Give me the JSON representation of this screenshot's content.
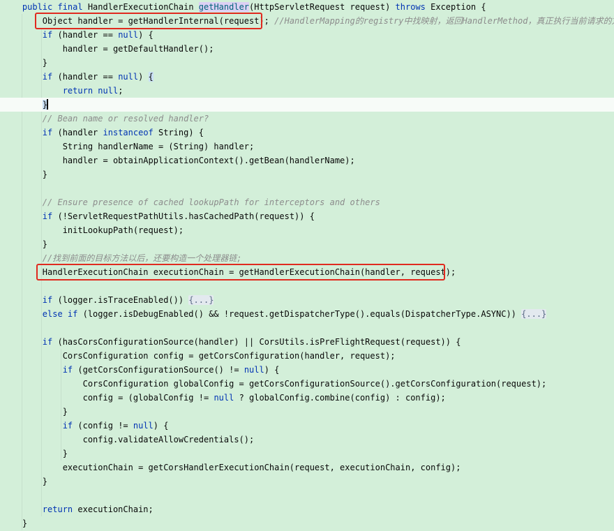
{
  "editor": {
    "lines": [
      {
        "segments": [
          {
            "t": "    ",
            "c": ""
          },
          {
            "t": "public final ",
            "c": "kw"
          },
          {
            "t": "HandlerExecutionChain ",
            "c": ""
          },
          {
            "t": "getHandler",
            "c": "method"
          },
          {
            "t": "(HttpServletRequest request) ",
            "c": ""
          },
          {
            "t": "throws ",
            "c": "kw"
          },
          {
            "t": "Exception {",
            "c": ""
          }
        ]
      },
      {
        "segments": [
          {
            "t": "        Object handler = getHandlerInternal(request); ",
            "c": ""
          },
          {
            "t": "//HandlerMapping的registry中找映射，返回HandlerMethod，真正执行当前请求的方法",
            "c": "cmt"
          }
        ]
      },
      {
        "segments": [
          {
            "t": "        ",
            "c": ""
          },
          {
            "t": "if ",
            "c": "kw"
          },
          {
            "t": "(handler == ",
            "c": ""
          },
          {
            "t": "null",
            "c": "kw"
          },
          {
            "t": ") {",
            "c": ""
          }
        ]
      },
      {
        "segments": [
          {
            "t": "            handler = getDefaultHandler();",
            "c": ""
          }
        ]
      },
      {
        "segments": [
          {
            "t": "        }",
            "c": ""
          }
        ]
      },
      {
        "segments": [
          {
            "t": "        ",
            "c": ""
          },
          {
            "t": "if ",
            "c": "kw"
          },
          {
            "t": "(handler == ",
            "c": ""
          },
          {
            "t": "null",
            "c": "kw"
          },
          {
            "t": ") ",
            "c": ""
          },
          {
            "t": "{",
            "c": "brace-match"
          }
        ]
      },
      {
        "segments": [
          {
            "t": "            ",
            "c": ""
          },
          {
            "t": "return null",
            "c": "kw"
          },
          {
            "t": ";",
            "c": ""
          }
        ]
      },
      {
        "segments": [
          {
            "t": "        ",
            "c": ""
          },
          {
            "t": "}",
            "c": "brace-match"
          },
          {
            "t": "",
            "c": "caret"
          }
        ],
        "current": true
      },
      {
        "segments": [
          {
            "t": "        ",
            "c": ""
          },
          {
            "t": "// Bean name or resolved handler?",
            "c": "cmt"
          }
        ]
      },
      {
        "segments": [
          {
            "t": "        ",
            "c": ""
          },
          {
            "t": "if ",
            "c": "kw"
          },
          {
            "t": "(handler ",
            "c": ""
          },
          {
            "t": "instanceof ",
            "c": "kw"
          },
          {
            "t": "String) {",
            "c": ""
          }
        ]
      },
      {
        "segments": [
          {
            "t": "            String handlerName = (String) handler;",
            "c": ""
          }
        ]
      },
      {
        "segments": [
          {
            "t": "            handler = obtainApplicationContext().getBean(handlerName);",
            "c": ""
          }
        ]
      },
      {
        "segments": [
          {
            "t": "        }",
            "c": ""
          }
        ]
      },
      {
        "segments": []
      },
      {
        "segments": [
          {
            "t": "        ",
            "c": ""
          },
          {
            "t": "// Ensure presence of cached lookupPath for interceptors and others",
            "c": "cmt"
          }
        ]
      },
      {
        "segments": [
          {
            "t": "        ",
            "c": ""
          },
          {
            "t": "if ",
            "c": "kw"
          },
          {
            "t": "(!ServletRequestPathUtils.hasCachedPath(request)) {",
            "c": ""
          }
        ]
      },
      {
        "segments": [
          {
            "t": "            initLookupPath(request);",
            "c": ""
          }
        ]
      },
      {
        "segments": [
          {
            "t": "        }",
            "c": ""
          }
        ]
      },
      {
        "segments": [
          {
            "t": "        ",
            "c": ""
          },
          {
            "t": "//找到前面的目标方法以后，还要构造一个处理器链;",
            "c": "cmt"
          }
        ]
      },
      {
        "segments": [
          {
            "t": "        HandlerExecutionChain executionChain = getHandlerExecutionChain(handler, request);",
            "c": ""
          }
        ]
      },
      {
        "segments": []
      },
      {
        "segments": [
          {
            "t": "        ",
            "c": ""
          },
          {
            "t": "if ",
            "c": "kw"
          },
          {
            "t": "(logger.isTraceEnabled()) ",
            "c": ""
          },
          {
            "t": "{...}",
            "c": "fold"
          }
        ]
      },
      {
        "segments": [
          {
            "t": "        ",
            "c": ""
          },
          {
            "t": "else if ",
            "c": "kw"
          },
          {
            "t": "(logger.isDebugEnabled() && !request.getDispatcherType().equals(DispatcherType.ASYNC)) ",
            "c": ""
          },
          {
            "t": "{...}",
            "c": "fold"
          }
        ]
      },
      {
        "segments": []
      },
      {
        "segments": [
          {
            "t": "        ",
            "c": ""
          },
          {
            "t": "if ",
            "c": "kw"
          },
          {
            "t": "(hasCorsConfigurationSource(handler) || CorsUtils.isPreFlightRequest(request)) {",
            "c": ""
          }
        ]
      },
      {
        "segments": [
          {
            "t": "            CorsConfiguration config = getCorsConfiguration(handler, request);",
            "c": ""
          }
        ]
      },
      {
        "segments": [
          {
            "t": "            ",
            "c": ""
          },
          {
            "t": "if ",
            "c": "kw"
          },
          {
            "t": "(getCorsConfigurationSource() != ",
            "c": ""
          },
          {
            "t": "null",
            "c": "kw"
          },
          {
            "t": ") {",
            "c": ""
          }
        ]
      },
      {
        "segments": [
          {
            "t": "                CorsConfiguration globalConfig = getCorsConfigurationSource().getCorsConfiguration(request);",
            "c": ""
          }
        ]
      },
      {
        "segments": [
          {
            "t": "                config = (globalConfig != ",
            "c": ""
          },
          {
            "t": "null ",
            "c": "kw"
          },
          {
            "t": "? globalConfig.combine(config) : config);",
            "c": ""
          }
        ]
      },
      {
        "segments": [
          {
            "t": "            }",
            "c": ""
          }
        ]
      },
      {
        "segments": [
          {
            "t": "            ",
            "c": ""
          },
          {
            "t": "if ",
            "c": "kw"
          },
          {
            "t": "(config != ",
            "c": ""
          },
          {
            "t": "null",
            "c": "kw"
          },
          {
            "t": ") {",
            "c": ""
          }
        ]
      },
      {
        "segments": [
          {
            "t": "                config.validateAllowCredentials();",
            "c": ""
          }
        ]
      },
      {
        "segments": [
          {
            "t": "            }",
            "c": ""
          }
        ]
      },
      {
        "segments": [
          {
            "t": "            executionChain = getCorsHandlerExecutionChain(request, executionChain, config);",
            "c": ""
          }
        ]
      },
      {
        "segments": [
          {
            "t": "        }",
            "c": ""
          }
        ]
      },
      {
        "segments": []
      },
      {
        "segments": [
          {
            "t": "        ",
            "c": ""
          },
          {
            "t": "return ",
            "c": "kw"
          },
          {
            "t": "executionChain;",
            "c": ""
          }
        ]
      },
      {
        "segments": [
          {
            "t": "    }",
            "c": ""
          }
        ]
      }
    ]
  },
  "annotations": {
    "box_color": "#e02a1f",
    "boxes": [
      {
        "label": "getHandlerInternal call",
        "line": 1
      },
      {
        "label": "getHandlerExecutionChain call",
        "line": 19
      }
    ]
  },
  "colors": {
    "background": "#d3efd9",
    "current_line": "#f7fbf8",
    "keyword": "#0033b3",
    "comment": "#8c8c8c",
    "method_highlight": "#dcd0f4"
  }
}
